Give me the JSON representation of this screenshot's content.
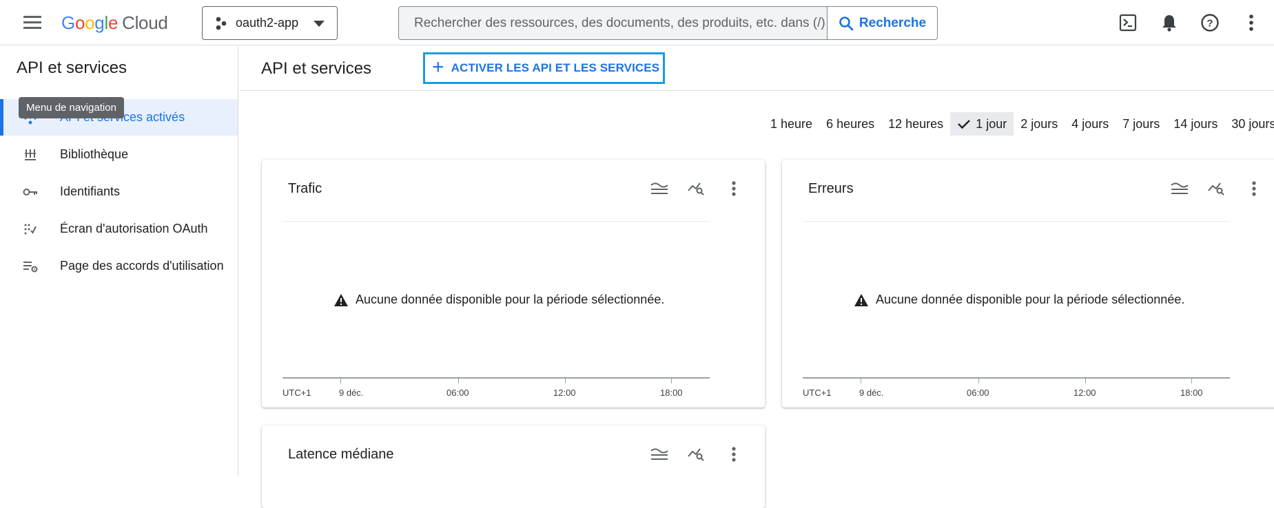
{
  "header": {
    "logo_google": "Google",
    "logo_cloud": "Cloud",
    "project": "oauth2-app",
    "search_placeholder": "Rechercher des ressources, des documents, des produits, etc. dans (/)",
    "search_button": "Recherche",
    "icons": [
      "cloud-shell-icon",
      "notifications-icon",
      "help-icon",
      "more-vert-icon"
    ]
  },
  "sidebar": {
    "title": "API et services",
    "tooltip": "Menu de navigation",
    "items": [
      {
        "label": "API et services activés",
        "icon": "api-diamond-icon",
        "active": true
      },
      {
        "label": "Bibliothèque",
        "icon": "library-icon",
        "active": false
      },
      {
        "label": "Identifiants",
        "icon": "key-icon",
        "active": false
      },
      {
        "label": "Écran d'autorisation OAuth",
        "icon": "oauth-consent-icon",
        "active": false
      },
      {
        "label": "Page des accords d'utilisation",
        "icon": "agreements-icon",
        "active": false
      }
    ]
  },
  "main": {
    "title": "API et services",
    "enable_button": "ACTIVER LES API ET LES SERVICES",
    "time_ranges": [
      "1 heure",
      "6 heures",
      "12 heures",
      "1 jour",
      "2 jours",
      "4 jours",
      "7 jours",
      "14 jours",
      "30 jours"
    ],
    "selected_range": "1 jour",
    "cards": [
      {
        "title": "Trafic",
        "message": "Aucune donnée disponible pour la période sélectionnée.",
        "axis": [
          "UTC+1",
          "9 déc.",
          "06:00",
          "12:00",
          "18:00"
        ]
      },
      {
        "title": "Erreurs",
        "message": "Aucune donnée disponible pour la période sélectionnée.",
        "axis": [
          "UTC+1",
          "9 déc.",
          "06:00",
          "12:00",
          "18:00"
        ]
      },
      {
        "title": "Latence médiane"
      }
    ]
  },
  "colors": {
    "accent": "#1a73e8",
    "highlight_border": "#1a9be0",
    "active_bg": "#e8f0fe"
  }
}
